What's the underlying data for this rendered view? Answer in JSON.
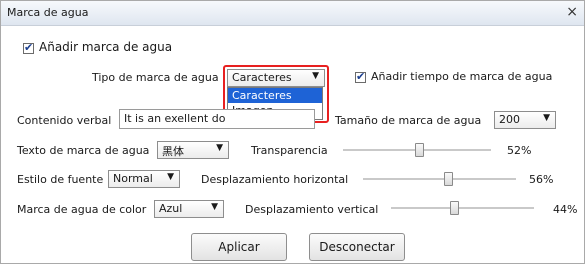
{
  "window": {
    "title": "Marca de agua",
    "close_glyph": "×"
  },
  "add_watermark": {
    "label": "Añadir marca de agua",
    "checked": true
  },
  "watermark_type": {
    "label": "Tipo de marca de agua",
    "value": "Caracteres",
    "options": [
      "Caracteres",
      "Imagen"
    ]
  },
  "add_time": {
    "label": "Añadir tiempo de marca de agua",
    "checked": true
  },
  "content": {
    "label": "Contenido verbal",
    "value": "It is an exellent do"
  },
  "size": {
    "label": "Tamaño de marca de agua",
    "value": "200"
  },
  "font": {
    "label": "Texto de marca de agua",
    "value": "黑体"
  },
  "transparency": {
    "label": "Transparencia",
    "value_text": "52%",
    "value": 0.52
  },
  "style": {
    "label": "Estilo de fuente",
    "value": "Normal"
  },
  "hoffset": {
    "label": "Desplazamiento horizontal",
    "value_text": "56%",
    "value": 0.56
  },
  "color": {
    "label": "Marca de agua de color",
    "value": "Azul"
  },
  "voffset": {
    "label": "Desplazamiento vertical",
    "value_text": "44%",
    "value": 0.44
  },
  "buttons": {
    "apply": "Aplicar",
    "disconnect": "Desconectar"
  },
  "colors": {
    "highlight": "#1e63d6",
    "annotation": "#e82020"
  }
}
